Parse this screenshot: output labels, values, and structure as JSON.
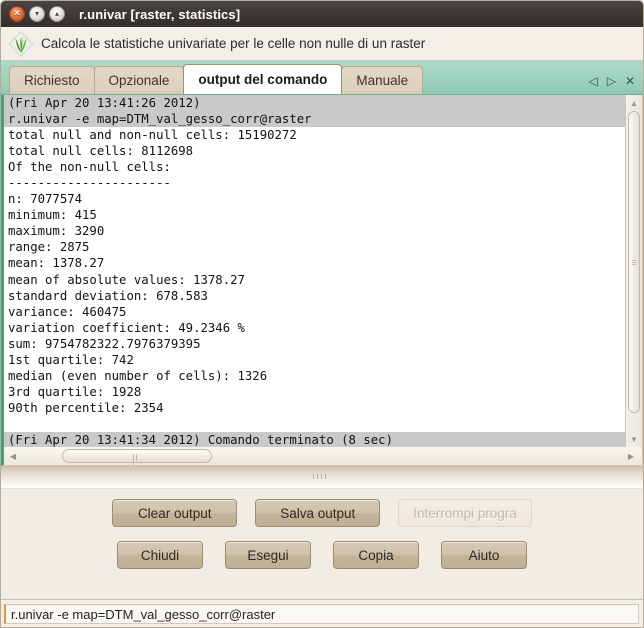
{
  "window": {
    "title": "r.univar [raster, statistics]",
    "controls": {
      "close": "×",
      "minimize": "▾",
      "maximize": "▴"
    }
  },
  "description": "Calcola le statistiche univariate per le celle non nulle di un raster",
  "tabs": [
    {
      "label": "Richiesto",
      "active": false
    },
    {
      "label": "Opzionale",
      "active": false
    },
    {
      "label": "output del comando",
      "active": true
    },
    {
      "label": "Manuale",
      "active": false
    }
  ],
  "tab_nav": {
    "prev": "◁",
    "next": "▷",
    "close": "✕"
  },
  "output": {
    "lines": [
      {
        "text": "(Fri Apr 20 13:41:26 2012)",
        "highlight": true
      },
      {
        "text": "r.univar -e map=DTM_val_gesso_corr@raster",
        "highlight": true
      },
      {
        "text": "total null and non-null cells: 15190272",
        "highlight": false
      },
      {
        "text": "total null cells: 8112698",
        "highlight": false
      },
      {
        "text": "Of the non-null cells:",
        "highlight": false
      },
      {
        "text": "----------------------",
        "highlight": false
      },
      {
        "text": "n: 7077574",
        "highlight": false
      },
      {
        "text": "minimum: 415",
        "highlight": false
      },
      {
        "text": "maximum: 3290",
        "highlight": false
      },
      {
        "text": "range: 2875",
        "highlight": false
      },
      {
        "text": "mean: 1378.27",
        "highlight": false
      },
      {
        "text": "mean of absolute values: 1378.27",
        "highlight": false
      },
      {
        "text": "standard deviation: 678.583",
        "highlight": false
      },
      {
        "text": "variance: 460475",
        "highlight": false
      },
      {
        "text": "variation coefficient: 49.2346 %",
        "highlight": false
      },
      {
        "text": "sum: 9754782322.7976379395",
        "highlight": false
      },
      {
        "text": "1st quartile: 742",
        "highlight": false
      },
      {
        "text": "median (even number of cells): 1326",
        "highlight": false
      },
      {
        "text": "3rd quartile: 1928",
        "highlight": false
      },
      {
        "text": "90th percentile: 2354",
        "highlight": false
      },
      {
        "text": "",
        "highlight": false
      },
      {
        "text": "(Fri Apr 20 13:41:34 2012) Comando terminato (8 sec)",
        "highlight": true
      }
    ],
    "scroll_arrows": {
      "up": "▲",
      "down": "▼",
      "left": "◀",
      "right": "▶"
    }
  },
  "buttons": {
    "row1": [
      {
        "label": "Clear output",
        "disabled": false
      },
      {
        "label": "Salva output",
        "disabled": false
      },
      {
        "label": "Interrompi progra",
        "disabled": true
      }
    ],
    "row2": [
      {
        "label": "Chiudi",
        "disabled": false
      },
      {
        "label": "Esegui",
        "disabled": false
      },
      {
        "label": "Copia",
        "disabled": false
      },
      {
        "label": "Aiuto",
        "disabled": false
      }
    ]
  },
  "statusbar": {
    "command": "r.univar -e map=DTM_val_gesso_corr@raster"
  },
  "colors": {
    "titlebar": "#3b3734",
    "tabbar_teal": "#9fd3bf",
    "tab_tan": "#dccfba",
    "button_tan": "#cfc1a9",
    "panel_bg": "#f1ece4",
    "highlight_gray": "#c9c9c9",
    "accent_green": "#4aa07a",
    "status_accent": "#d99a3f"
  }
}
